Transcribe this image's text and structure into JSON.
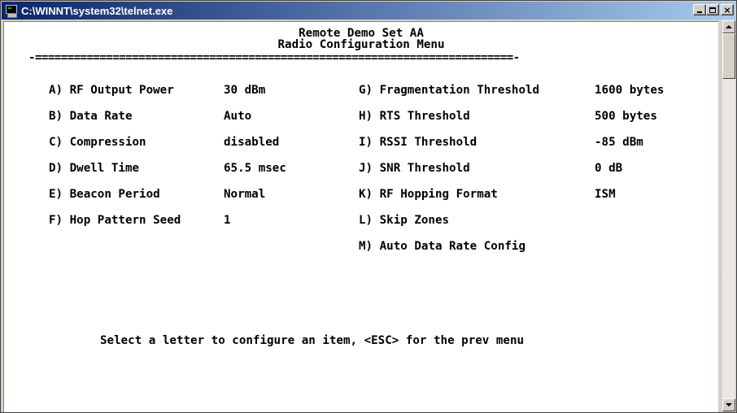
{
  "window": {
    "title": "C:\\WINNT\\system32\\telnet.exe",
    "buttons": {
      "minimize": "_",
      "maximize": "□",
      "close": "×"
    }
  },
  "terminal": {
    "header_line1": "Remote Demo Set AA",
    "header_line2": "Radio Configuration Menu",
    "separator": "-==========================================================================-",
    "items_left": [
      {
        "key": "A)",
        "label": "RF Output Power",
        "value": "30 dBm"
      },
      {
        "key": "B)",
        "label": "Data Rate",
        "value": "Auto"
      },
      {
        "key": "C)",
        "label": "Compression",
        "value": "disabled"
      },
      {
        "key": "D)",
        "label": "Dwell Time",
        "value": "65.5 msec"
      },
      {
        "key": "E)",
        "label": "Beacon Period",
        "value": "Normal"
      },
      {
        "key": "F)",
        "label": "Hop Pattern Seed",
        "value": "1"
      }
    ],
    "items_right": [
      {
        "key": "G)",
        "label": "Fragmentation Threshold",
        "value": "1600 bytes"
      },
      {
        "key": "H)",
        "label": "RTS Threshold",
        "value": "500 bytes"
      },
      {
        "key": "I)",
        "label": "RSSI Threshold",
        "value": "-85 dBm"
      },
      {
        "key": "J)",
        "label": "SNR Threshold",
        "value": "0 dB"
      },
      {
        "key": "K)",
        "label": "RF Hopping Format",
        "value": "ISM"
      },
      {
        "key": "L)",
        "label": "Skip Zones",
        "value": ""
      },
      {
        "key": "M)",
        "label": "Auto Data Rate Config",
        "value": ""
      }
    ],
    "prompt": "Select a letter to configure an item, <ESC> for the prev menu"
  }
}
